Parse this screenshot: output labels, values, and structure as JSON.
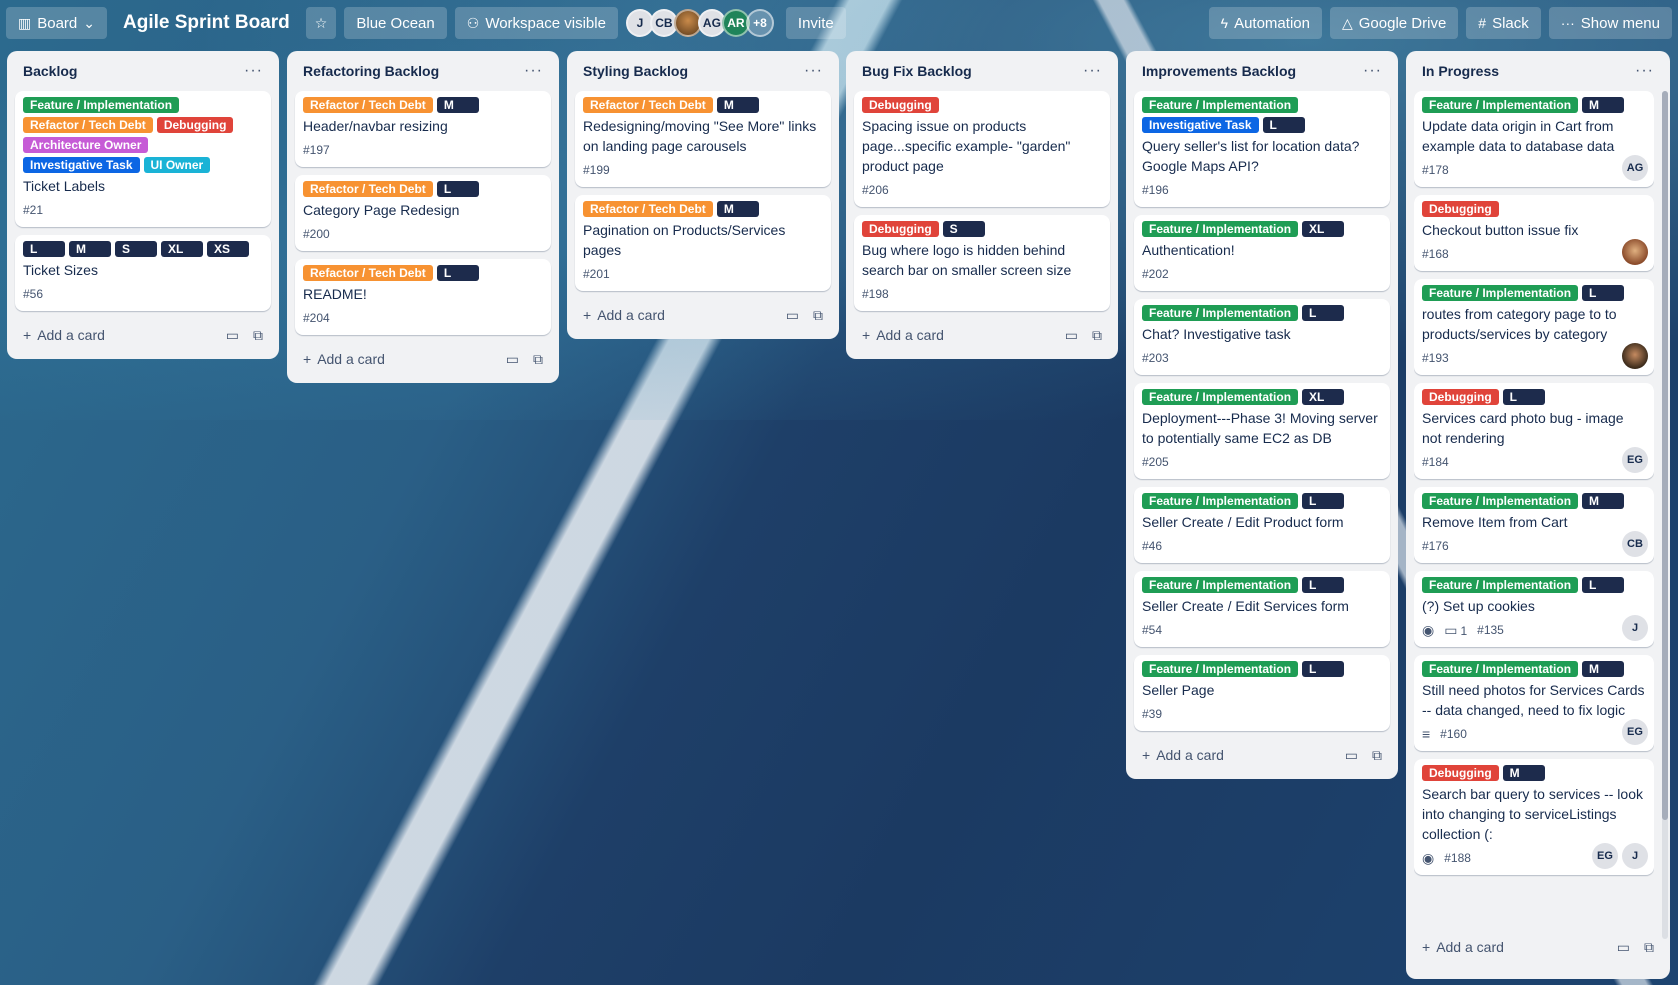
{
  "colors": {
    "feature": "#1f9d55",
    "refactor": "#f79232",
    "debugging": "#e0443a",
    "architecture": "#c65bd6",
    "investigative": "#0c66e4",
    "ui": "#1ab3d6",
    "size": "#1d2b4c"
  },
  "header": {
    "view_label": "Board",
    "title": "Agile Sprint Board",
    "team": "Blue Ocean",
    "visibility": "Workspace visible",
    "avatars": [
      "J",
      "CB",
      "",
      "AG",
      "AR"
    ],
    "more_members": "+8",
    "invite": "Invite",
    "automation": "Automation",
    "google_drive": "Google Drive",
    "slack": "Slack",
    "show_menu": "Show menu"
  },
  "add_card": "Add a card",
  "lists": [
    {
      "title": "Backlog",
      "cards": [
        {
          "labels": [
            {
              "t": "Feature / Implementation",
              "c": "feature"
            },
            {
              "t": "Refactor / Tech Debt",
              "c": "refactor"
            },
            {
              "t": "Debugging",
              "c": "debugging"
            },
            {
              "t": "Architecture Owner",
              "c": "architecture"
            },
            {
              "t": "Investigative Task",
              "c": "investigative"
            },
            {
              "t": "UI Owner",
              "c": "ui"
            }
          ],
          "title": "Ticket Labels",
          "num": "#21"
        },
        {
          "labels": [
            {
              "t": "L",
              "c": "size"
            },
            {
              "t": "M",
              "c": "size"
            },
            {
              "t": "S",
              "c": "size"
            },
            {
              "t": "XL",
              "c": "size"
            },
            {
              "t": "XS",
              "c": "size"
            }
          ],
          "title": "Ticket Sizes",
          "num": "#56"
        }
      ]
    },
    {
      "title": "Refactoring Backlog",
      "cards": [
        {
          "labels": [
            {
              "t": "Refactor / Tech Debt",
              "c": "refactor"
            },
            {
              "t": "M",
              "c": "size"
            }
          ],
          "title": "Header/navbar resizing",
          "num": "#197"
        },
        {
          "labels": [
            {
              "t": "Refactor / Tech Debt",
              "c": "refactor"
            },
            {
              "t": "L",
              "c": "size"
            }
          ],
          "title": "Category Page Redesign",
          "num": "#200"
        },
        {
          "labels": [
            {
              "t": "Refactor / Tech Debt",
              "c": "refactor"
            },
            {
              "t": "L",
              "c": "size"
            }
          ],
          "title": "README!",
          "num": "#204"
        }
      ]
    },
    {
      "title": "Styling Backlog",
      "cards": [
        {
          "labels": [
            {
              "t": "Refactor / Tech Debt",
              "c": "refactor"
            },
            {
              "t": "M",
              "c": "size"
            }
          ],
          "title": "Redesigning/moving \"See More\" links on landing page carousels",
          "num": "#199"
        },
        {
          "labels": [
            {
              "t": "Refactor / Tech Debt",
              "c": "refactor"
            },
            {
              "t": "M",
              "c": "size"
            }
          ],
          "title": "Pagination on Products/Services pages",
          "num": "#201"
        }
      ]
    },
    {
      "title": "Bug Fix Backlog",
      "cards": [
        {
          "labels": [
            {
              "t": "Debugging",
              "c": "debugging"
            }
          ],
          "title": "Spacing issue on products page...specific example- \"garden\" product page",
          "num": "#206"
        },
        {
          "labels": [
            {
              "t": "Debugging",
              "c": "debugging"
            },
            {
              "t": "S",
              "c": "size"
            }
          ],
          "title": "Bug where logo is hidden behind search bar on smaller screen size",
          "num": "#198"
        }
      ]
    },
    {
      "title": "Improvements Backlog",
      "cards": [
        {
          "labels": [
            {
              "t": "Feature / Implementation",
              "c": "feature"
            },
            {
              "t": "Investigative Task",
              "c": "investigative"
            },
            {
              "t": "L",
              "c": "size"
            }
          ],
          "title": "Query seller's list for location data? Google Maps API?",
          "num": "#196"
        },
        {
          "labels": [
            {
              "t": "Feature / Implementation",
              "c": "feature"
            },
            {
              "t": "XL",
              "c": "size"
            }
          ],
          "title": "Authentication!",
          "num": "#202"
        },
        {
          "labels": [
            {
              "t": "Feature / Implementation",
              "c": "feature"
            },
            {
              "t": "L",
              "c": "size"
            }
          ],
          "title": "Chat? Investigative task",
          "num": "#203"
        },
        {
          "labels": [
            {
              "t": "Feature / Implementation",
              "c": "feature"
            },
            {
              "t": "XL",
              "c": "size"
            }
          ],
          "title": "Deployment---Phase 3! Moving server to potentially same EC2 as DB",
          "num": "#205"
        },
        {
          "labels": [
            {
              "t": "Feature / Implementation",
              "c": "feature"
            },
            {
              "t": "L",
              "c": "size"
            }
          ],
          "title": "Seller Create / Edit Product form",
          "num": "#46"
        },
        {
          "labels": [
            {
              "t": "Feature / Implementation",
              "c": "feature"
            },
            {
              "t": "L",
              "c": "size"
            }
          ],
          "title": "Seller Create / Edit Services form",
          "num": "#54"
        },
        {
          "labels": [
            {
              "t": "Feature / Implementation",
              "c": "feature"
            },
            {
              "t": "L",
              "c": "size"
            }
          ],
          "title": "Seller Page",
          "num": "#39"
        }
      ]
    },
    {
      "title": "In Progress",
      "cards": [
        {
          "labels": [
            {
              "t": "Feature / Implementation",
              "c": "feature"
            },
            {
              "t": "M",
              "c": "size"
            }
          ],
          "title": "Update data origin in Cart from example data to database data",
          "num": "#178",
          "members": [
            "AG"
          ]
        },
        {
          "labels": [
            {
              "t": "Debugging",
              "c": "debugging"
            }
          ],
          "title": "Checkout button issue fix",
          "num": "#168",
          "members": [
            ""
          ],
          "photo": "photo1"
        },
        {
          "labels": [
            {
              "t": "Feature / Implementation",
              "c": "feature"
            },
            {
              "t": "L",
              "c": "size"
            }
          ],
          "title": "routes from category page to to products/services by category",
          "num": "#193",
          "members": [
            ""
          ],
          "photo": "photo2"
        },
        {
          "labels": [
            {
              "t": "Debugging",
              "c": "debugging"
            },
            {
              "t": "L",
              "c": "size"
            }
          ],
          "title": "Services card photo bug - image not rendering",
          "num": "#184",
          "members": [
            "EG"
          ]
        },
        {
          "labels": [
            {
              "t": "Feature / Implementation",
              "c": "feature"
            },
            {
              "t": "M",
              "c": "size"
            }
          ],
          "title": "Remove Item from Cart",
          "num": "#176",
          "members": [
            "CB"
          ]
        },
        {
          "labels": [
            {
              "t": "Feature / Implementation",
              "c": "feature"
            },
            {
              "t": "L",
              "c": "size"
            }
          ],
          "title": "(?) Set up cookies",
          "num": "#135",
          "watch": true,
          "comments": "1",
          "members": [
            "J"
          ]
        },
        {
          "labels": [
            {
              "t": "Feature / Implementation",
              "c": "feature"
            },
            {
              "t": "M",
              "c": "size"
            }
          ],
          "title": "Still need photos for Services Cards -- data changed, need to fix logic",
          "num": "#160",
          "desc": true,
          "members": [
            "EG"
          ]
        },
        {
          "labels": [
            {
              "t": "Debugging",
              "c": "debugging"
            },
            {
              "t": "M",
              "c": "size"
            }
          ],
          "title": "Search bar query to services -- look into changing to serviceListings collection (:",
          "num": "#188",
          "watch": true,
          "members": [
            "EG",
            "J"
          ]
        }
      ]
    }
  ]
}
